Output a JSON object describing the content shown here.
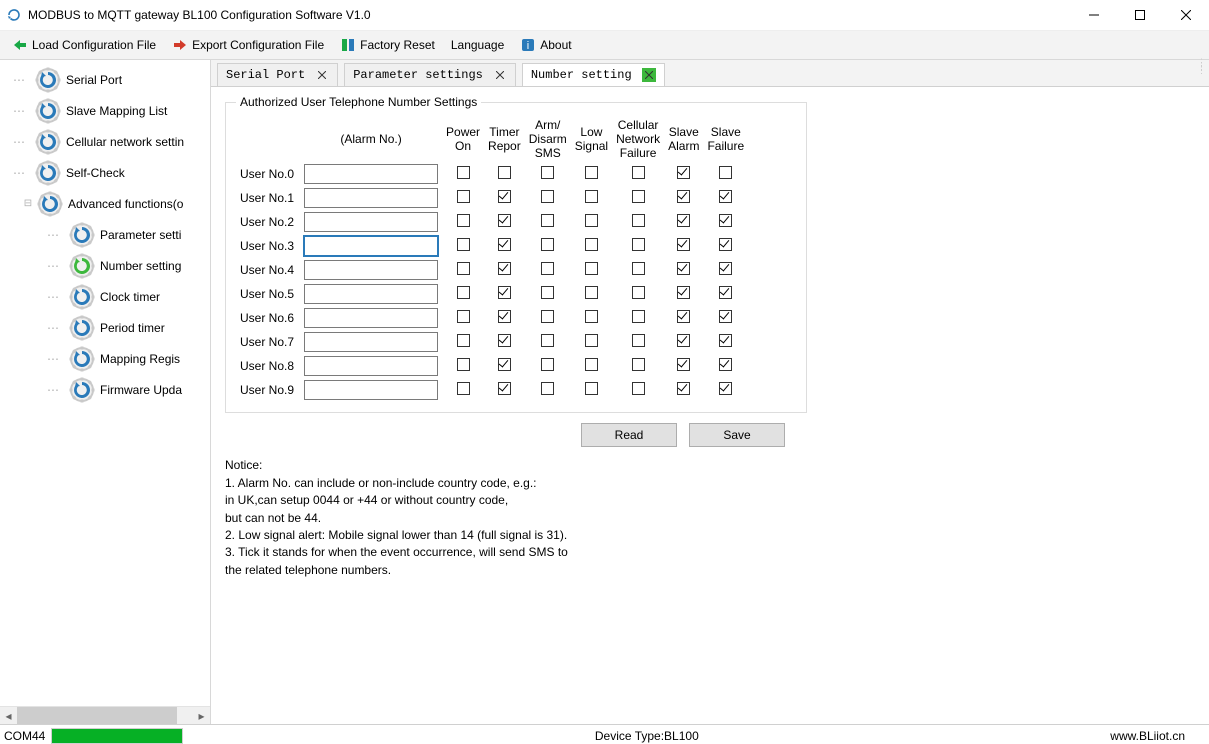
{
  "window": {
    "title": "MODBUS to MQTT gateway BL100 Configuration Software V1.0"
  },
  "toolbar": {
    "load": "Load Configuration File",
    "export": "Export Configuration File",
    "factory": "Factory Reset",
    "language": "Language",
    "about": "About"
  },
  "tree": {
    "items": [
      "Serial Port",
      "Slave Mapping List",
      "Cellular network settin",
      "Self-Check",
      "Advanced functions(o"
    ],
    "children": [
      "Parameter setti",
      "Number setting",
      "Clock timer",
      "Period timer",
      "Mapping Regis",
      "Firmware Upda"
    ],
    "expand_symbol": "⊟"
  },
  "tabs": [
    {
      "label": "Serial Port",
      "active": false
    },
    {
      "label": "Parameter settings",
      "active": false
    },
    {
      "label": "Number setting",
      "active": true
    }
  ],
  "tel": {
    "legend": "Authorized User Telephone Number Settings",
    "header_alarm": "(Alarm No.)",
    "cols": [
      "Power\nOn",
      "Timer\nRepor",
      "Arm/\nDisarm\nSMS",
      "Low\nSignal",
      "Cellular\nNetwork\nFailure",
      "Slave\nAlarm",
      "Slave\nFailure"
    ],
    "rows": [
      {
        "label": "User No.0",
        "value": "",
        "c": [
          false,
          false,
          false,
          false,
          false,
          true,
          false
        ]
      },
      {
        "label": "User No.1",
        "value": "",
        "c": [
          false,
          true,
          false,
          false,
          false,
          true,
          true
        ]
      },
      {
        "label": "User No.2",
        "value": "",
        "c": [
          false,
          true,
          false,
          false,
          false,
          true,
          true
        ]
      },
      {
        "label": "User No.3",
        "value": "",
        "c": [
          false,
          true,
          false,
          false,
          false,
          true,
          true
        ]
      },
      {
        "label": "User No.4",
        "value": "",
        "c": [
          false,
          true,
          false,
          false,
          false,
          true,
          true
        ]
      },
      {
        "label": "User No.5",
        "value": "",
        "c": [
          false,
          true,
          false,
          false,
          false,
          true,
          true
        ]
      },
      {
        "label": "User No.6",
        "value": "",
        "c": [
          false,
          true,
          false,
          false,
          false,
          true,
          true
        ]
      },
      {
        "label": "User No.7",
        "value": "",
        "c": [
          false,
          true,
          false,
          false,
          false,
          true,
          true
        ]
      },
      {
        "label": "User No.8",
        "value": "",
        "c": [
          false,
          true,
          false,
          false,
          false,
          true,
          true
        ]
      },
      {
        "label": "User No.9",
        "value": "",
        "c": [
          false,
          true,
          false,
          false,
          false,
          true,
          true
        ]
      }
    ],
    "focused_row": 3
  },
  "buttons": {
    "read": "Read",
    "save": "Save"
  },
  "notice": {
    "title": "Notice:",
    "lines": [
      "1. Alarm No. can include or non-include country code, e.g.:",
      "    in UK,can setup 0044 or +44 or without country code,",
      "    but can not be 44.",
      "2. Low signal alert: Mobile signal lower than 14 (full signal is 31).",
      "3. Tick it stands for when the event occurrence, will send SMS to",
      "    the related telephone numbers."
    ]
  },
  "status": {
    "port": "COM44",
    "device": "Device Type:BL100",
    "url": "www.BLiiot.cn"
  }
}
